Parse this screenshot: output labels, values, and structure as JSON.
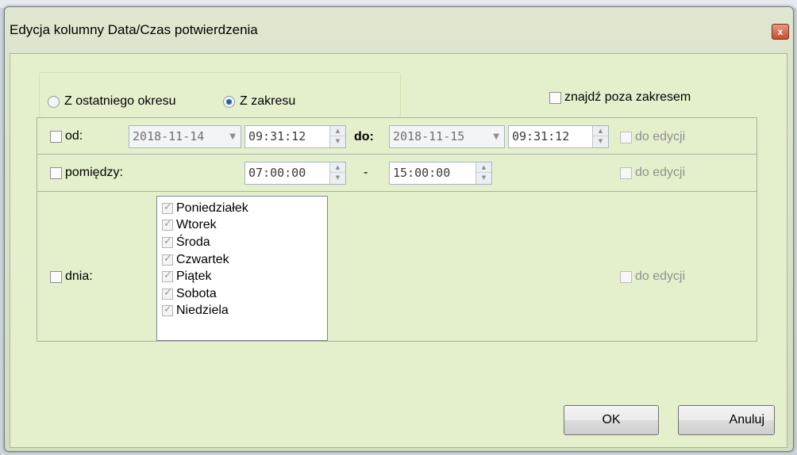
{
  "window": {
    "title": "Edycja kolumny Data/Czas potwierdzenia",
    "close_glyph": "x"
  },
  "mode": {
    "option_last_period": "Z ostatniego okresu",
    "option_range": "Z zakresu",
    "selected": "Z zakresu"
  },
  "find_outside": {
    "label": "znajdź poza zakresem",
    "checked": false
  },
  "from_row": {
    "checkbox_label": "od:",
    "from_date": "2018-11-14",
    "from_time": "09:31:12",
    "to_label": "do:",
    "to_date": "2018-11-15",
    "to_time": "09:31:12",
    "editable_label": "do edycji"
  },
  "between_row": {
    "checkbox_label": "pomiędzy:",
    "start_time": "07:00:00",
    "separator": "-",
    "end_time": "15:00:00",
    "editable_label": "do edycji"
  },
  "days_row": {
    "checkbox_label": "dnia:",
    "days": [
      "Poniedziałek",
      "Wtorek",
      "Środa",
      "Czwartek",
      "Piątek",
      "Sobota",
      "Niedziela"
    ],
    "editable_label": "do edycji"
  },
  "buttons": {
    "ok": "OK",
    "cancel": "Anuluj"
  },
  "icons": {
    "dropdown": "chevron-down-icon",
    "spin_up": "arrow-up-icon",
    "spin_down": "arrow-down-icon",
    "check": "check-icon"
  }
}
